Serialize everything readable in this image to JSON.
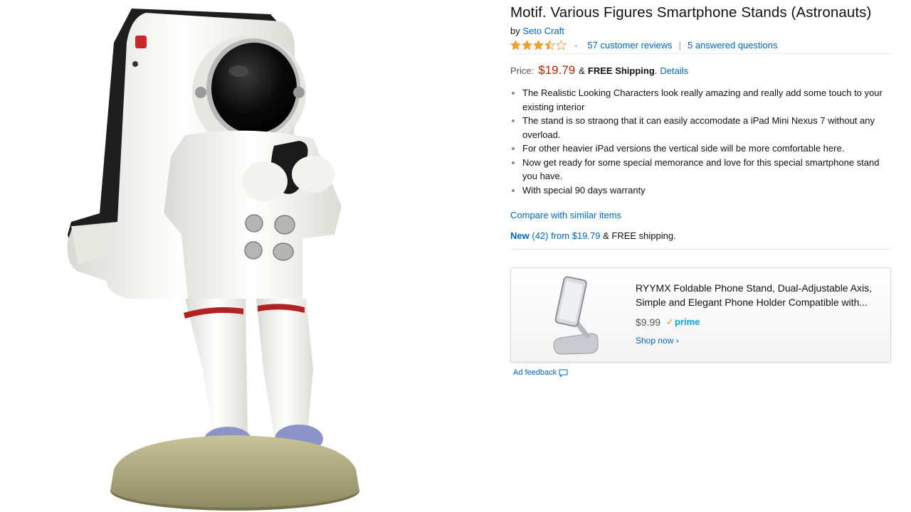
{
  "product": {
    "title": "Motif. Various Figures Smartphone Stands (Astronauts)",
    "by_prefix": "by",
    "brand": "Seto Craft",
    "rating_stars": 3.5,
    "reviews_link": "57 customer reviews",
    "separator": "|",
    "questions_link": "5 answered questions",
    "price_label": "Price:",
    "price": "$19.79",
    "ampersand": "&",
    "shipping": "FREE Shipping",
    "shipping_period": ".",
    "details_link": "Details",
    "bullets": [
      "The Realistic Looking Characters look really amazing and really add some touch to your existing interior",
      "The stand is so straong that it can easily accomodate a iPad Mini Nexus 7 without any overload.",
      "For other heavier iPad versions the vertical side will be more comfortable here.",
      "Now get ready for some special memorance and love for this special smartphone stand you have.",
      "With special 90 days warranty"
    ],
    "compare_link": "Compare with similar items",
    "offers": {
      "new_label": "New",
      "count_from": "(42) from $19.79",
      "suffix": "& FREE shipping."
    }
  },
  "ad": {
    "title": "RYYMX Foldable Phone Stand, Dual-Adjustable Axis, Simple and Elegant Phone Holder Compatible with...",
    "price": "$9.99",
    "prime": "prime",
    "shop_now": "Shop now ›",
    "feedback": "Ad feedback"
  },
  "colors": {
    "link": "#0066c0",
    "price": "#b12704",
    "star": "#ffa41c",
    "prime": "#00a8e1"
  }
}
